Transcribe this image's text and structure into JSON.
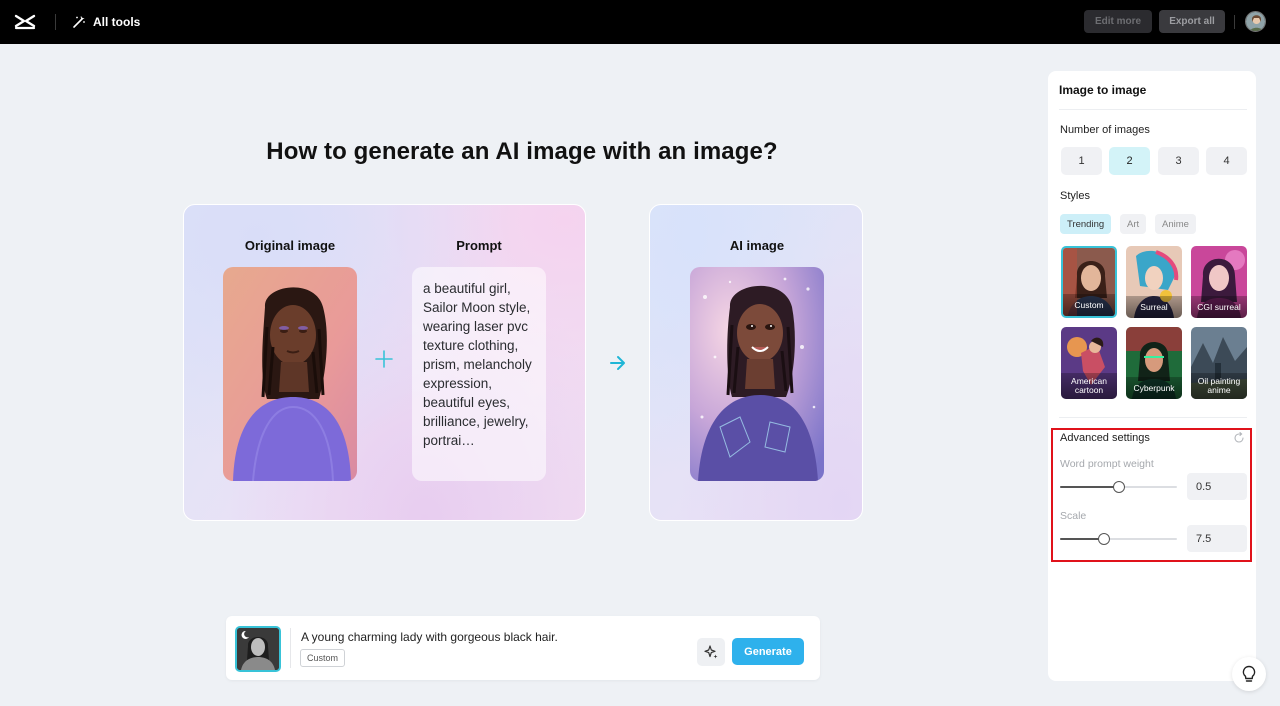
{
  "topbar": {
    "all_tools_label": "All tools",
    "edit_more_label": "Edit more",
    "export_all_label": "Export all"
  },
  "hero": {
    "title": "How to generate an AI image with an image?",
    "original_label": "Original image",
    "prompt_label": "Prompt",
    "ai_label": "AI image",
    "prompt_text": "a beautiful girl, Sailor Moon style, wearing laser pvc texture clothing, prism, melancholy expression, beautiful eyes, brilliance, jewelry, portrai…"
  },
  "prompt_bar": {
    "text": "A young charming lady with gorgeous black hair.",
    "style_chip": "Custom",
    "generate_label": "Generate"
  },
  "panel": {
    "title": "Image to image",
    "number_label": "Number of images",
    "numbers": [
      "1",
      "2",
      "3",
      "4"
    ],
    "selected_number": "2",
    "styles_label": "Styles",
    "style_tabs": [
      "Trending",
      "Art",
      "Anime"
    ],
    "active_tab": "Trending",
    "tiles": [
      {
        "label": "Custom",
        "selected": true
      },
      {
        "label": "Surreal",
        "selected": false
      },
      {
        "label": "CGI surreal",
        "selected": false
      },
      {
        "label": "American cartoon",
        "selected": false
      },
      {
        "label": "Cyberpunk",
        "selected": false
      },
      {
        "label": "Oil painting anime",
        "selected": false
      }
    ],
    "advanced_label": "Advanced settings",
    "word_prompt_weight_label": "Word prompt weight",
    "word_prompt_weight_value": "0.5",
    "word_prompt_weight_level": 0.5,
    "scale_label": "Scale",
    "scale_value": "7.5",
    "scale_level": 0.38
  },
  "colors": {
    "accent": "#2eb1ec",
    "selected_outline": "#38c3d8",
    "highlight_box": "#e0121b"
  }
}
